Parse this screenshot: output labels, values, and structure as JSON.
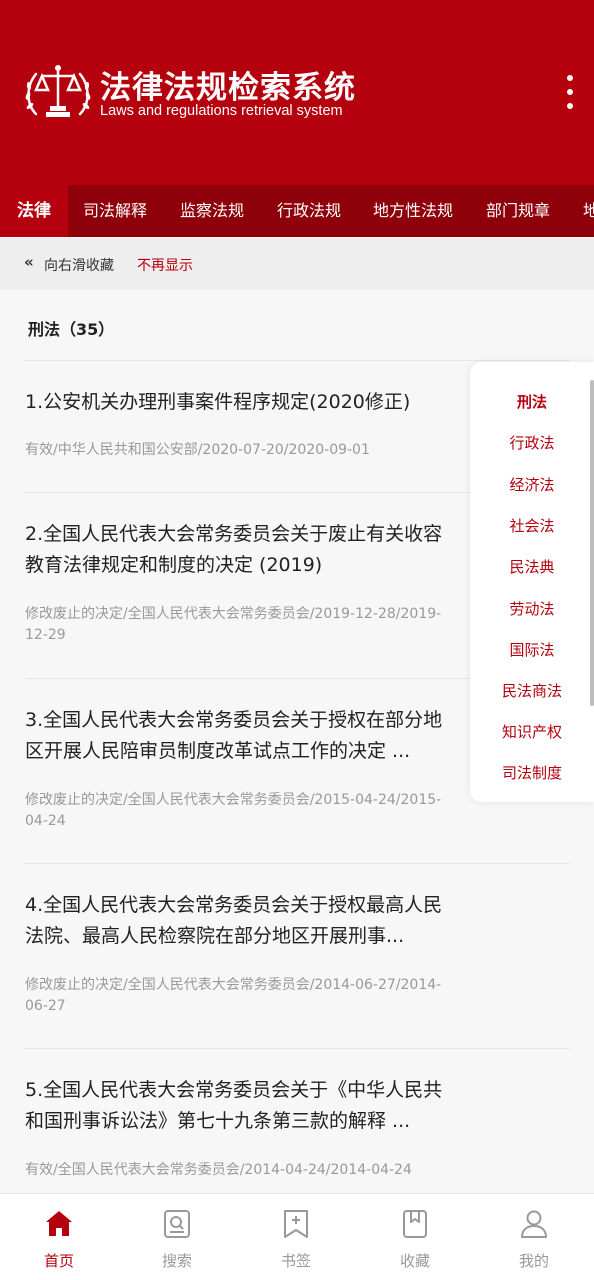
{
  "header": {
    "title": "法律法规检索系统",
    "subtitle": "Laws and regulations retrieval system",
    "logo_icon": "scales-of-justice-emblem",
    "menu_icon": "more-vertical-icon"
  },
  "tabs": [
    {
      "label": "法律",
      "active": true
    },
    {
      "label": "司法解释"
    },
    {
      "label": "监察法规"
    },
    {
      "label": "行政法规"
    },
    {
      "label": "地方性法规"
    },
    {
      "label": "部门规章"
    },
    {
      "label": "地"
    }
  ],
  "hint": {
    "chevron": "«",
    "text": "向右滑收藏",
    "dismiss": "不再显示"
  },
  "section": {
    "title": "刑法（35）"
  },
  "items": [
    {
      "title": "1.公安机关办理刑事案件程序规定(2020修正)",
      "meta": "有效/中华人民共和国公安部/2020-07-20/2020-09-01"
    },
    {
      "title": "2.全国人民代表大会常务委员会关于废止有关收容教育法律规定和制度的决定 (2019)",
      "meta": "修改废止的决定/全国人民代表大会常务委员会/2019-12-28/2019-12-29"
    },
    {
      "title": "3.全国人民代表大会常务委员会关于授权在部分地区开展人民陪审员制度改革试点工作的决定 ...",
      "meta": "修改废止的决定/全国人民代表大会常务委员会/2015-04-24/2015-04-24"
    },
    {
      "title": "4.全国人民代表大会常务委员会关于授权最高人民法院、最高人民检察院在部分地区开展刑事...",
      "meta": "修改废止的决定/全国人民代表大会常务委员会/2014-06-27/2014-06-27"
    },
    {
      "title": "5.全国人民代表大会常务委员会关于《中华人民共和国刑事诉讼法》第七十九条第三款的解释 ...",
      "meta": "有效/全国人民代表大会常务委员会/2014-04-24/2014-04-24"
    }
  ],
  "categories": [
    {
      "label": "刑法",
      "active": true
    },
    {
      "label": "行政法"
    },
    {
      "label": "经济法"
    },
    {
      "label": "社会法"
    },
    {
      "label": "民法典"
    },
    {
      "label": "劳动法"
    },
    {
      "label": "国际法"
    },
    {
      "label": "民法商法"
    },
    {
      "label": "知识产权"
    },
    {
      "label": "司法制度"
    }
  ],
  "bottom_nav": [
    {
      "label": "首页",
      "icon": "home-icon",
      "active": true
    },
    {
      "label": "搜索",
      "icon": "search-icon"
    },
    {
      "label": "书签",
      "icon": "bookmark-add-icon"
    },
    {
      "label": "收藏",
      "icon": "favorites-icon"
    },
    {
      "label": "我的",
      "icon": "user-icon"
    }
  ],
  "colors": {
    "brand_red": "#b5000d",
    "tab_bar_red": "#8e000a"
  }
}
